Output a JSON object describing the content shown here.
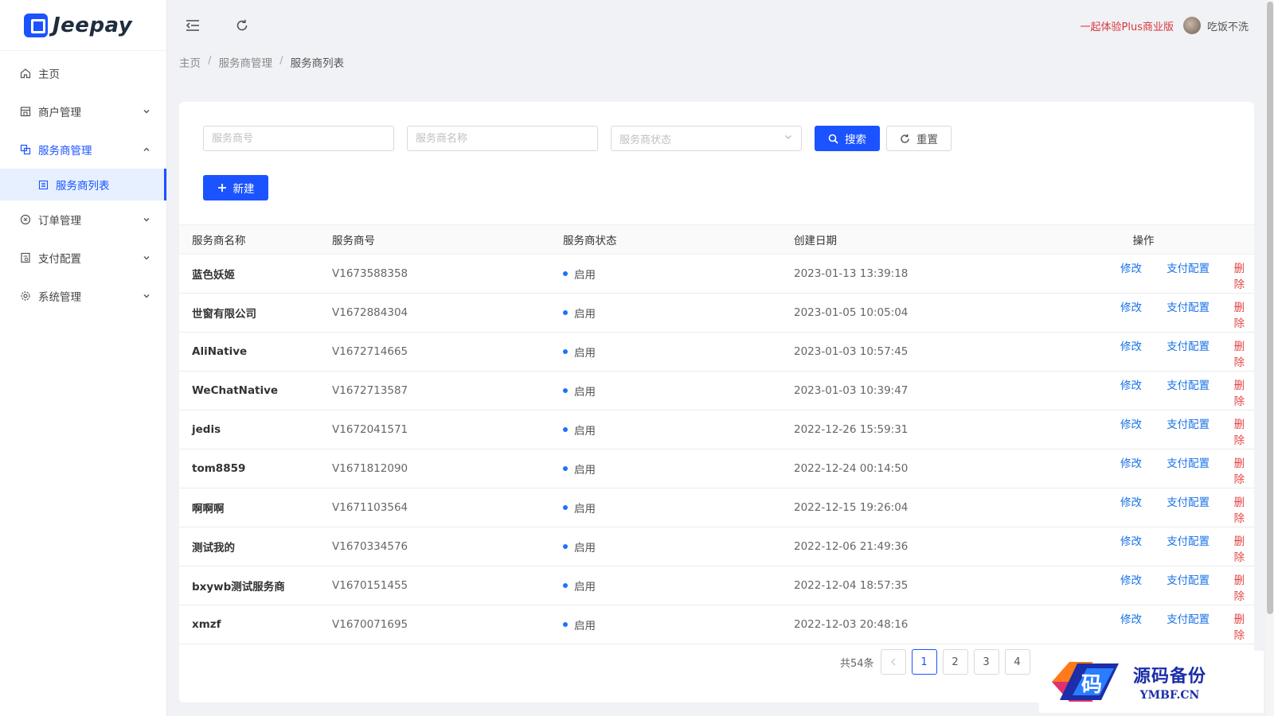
{
  "app": {
    "logo_text": "Jeepay"
  },
  "sidebar": {
    "items": [
      {
        "label": "主页",
        "icon": "home-icon"
      },
      {
        "label": "商户管理",
        "icon": "shop-icon"
      },
      {
        "label": "服务商管理",
        "icon": "isv-icon"
      },
      {
        "label": "服务商列表",
        "icon": "list-icon"
      },
      {
        "label": "订单管理",
        "icon": "order-icon"
      },
      {
        "label": "支付配置",
        "icon": "payconfig-icon"
      },
      {
        "label": "系统管理",
        "icon": "gear-icon"
      }
    ]
  },
  "header": {
    "plus_link": "一起体验Plus商业版",
    "username": "吃饭不洗"
  },
  "breadcrumb": [
    "主页",
    "服务商管理",
    "服务商列表"
  ],
  "filters": {
    "isv_no_placeholder": "服务商号",
    "isv_name_placeholder": "服务商名称",
    "status_placeholder": "服务商状态",
    "search_label": "搜索",
    "reset_label": "重置",
    "new_label": "新建"
  },
  "table": {
    "columns": [
      "服务商名称",
      "服务商号",
      "服务商状态",
      "创建日期",
      "操作"
    ],
    "rows": [
      {
        "name": "蓝色妖姬",
        "no": "V1673588358",
        "status": "启用",
        "created": "2023-01-13 13:39:18"
      },
      {
        "name": "世窗有限公司",
        "no": "V1672884304",
        "status": "启用",
        "created": "2023-01-05 10:05:04"
      },
      {
        "name": "AliNative",
        "no": "V1672714665",
        "status": "启用",
        "created": "2023-01-03 10:57:45"
      },
      {
        "name": "WeChatNative",
        "no": "V1672713587",
        "status": "启用",
        "created": "2023-01-03 10:39:47"
      },
      {
        "name": "jedis",
        "no": "V1672041571",
        "status": "启用",
        "created": "2022-12-26 15:59:31"
      },
      {
        "name": "tom8859",
        "no": "V1671812090",
        "status": "启用",
        "created": "2022-12-24 00:14:50"
      },
      {
        "name": "啊啊啊",
        "no": "V1671103564",
        "status": "启用",
        "created": "2022-12-15 19:26:04"
      },
      {
        "name": "测试我的",
        "no": "V1670334576",
        "status": "启用",
        "created": "2022-12-06 21:49:36"
      },
      {
        "name": "bxywb测试服务商",
        "no": "V1670151455",
        "status": "启用",
        "created": "2022-12-04 18:57:35"
      },
      {
        "name": "xmzf",
        "no": "V1670071695",
        "status": "启用",
        "created": "2022-12-03 20:48:16"
      }
    ],
    "actions": {
      "edit": "修改",
      "pay_config": "支付配置",
      "delete": "删除"
    }
  },
  "pagination": {
    "total_label": "共54条",
    "pages": [
      "1",
      "2",
      "3",
      "4"
    ],
    "current": "1"
  },
  "watermark": {
    "main": "源码备份",
    "sub": "YMBF.CN",
    "glyph": "码"
  },
  "colors": {
    "primary": "#1a53ff",
    "danger": "#e54545",
    "link": "#1a73e8",
    "plus": "#d9363e"
  }
}
